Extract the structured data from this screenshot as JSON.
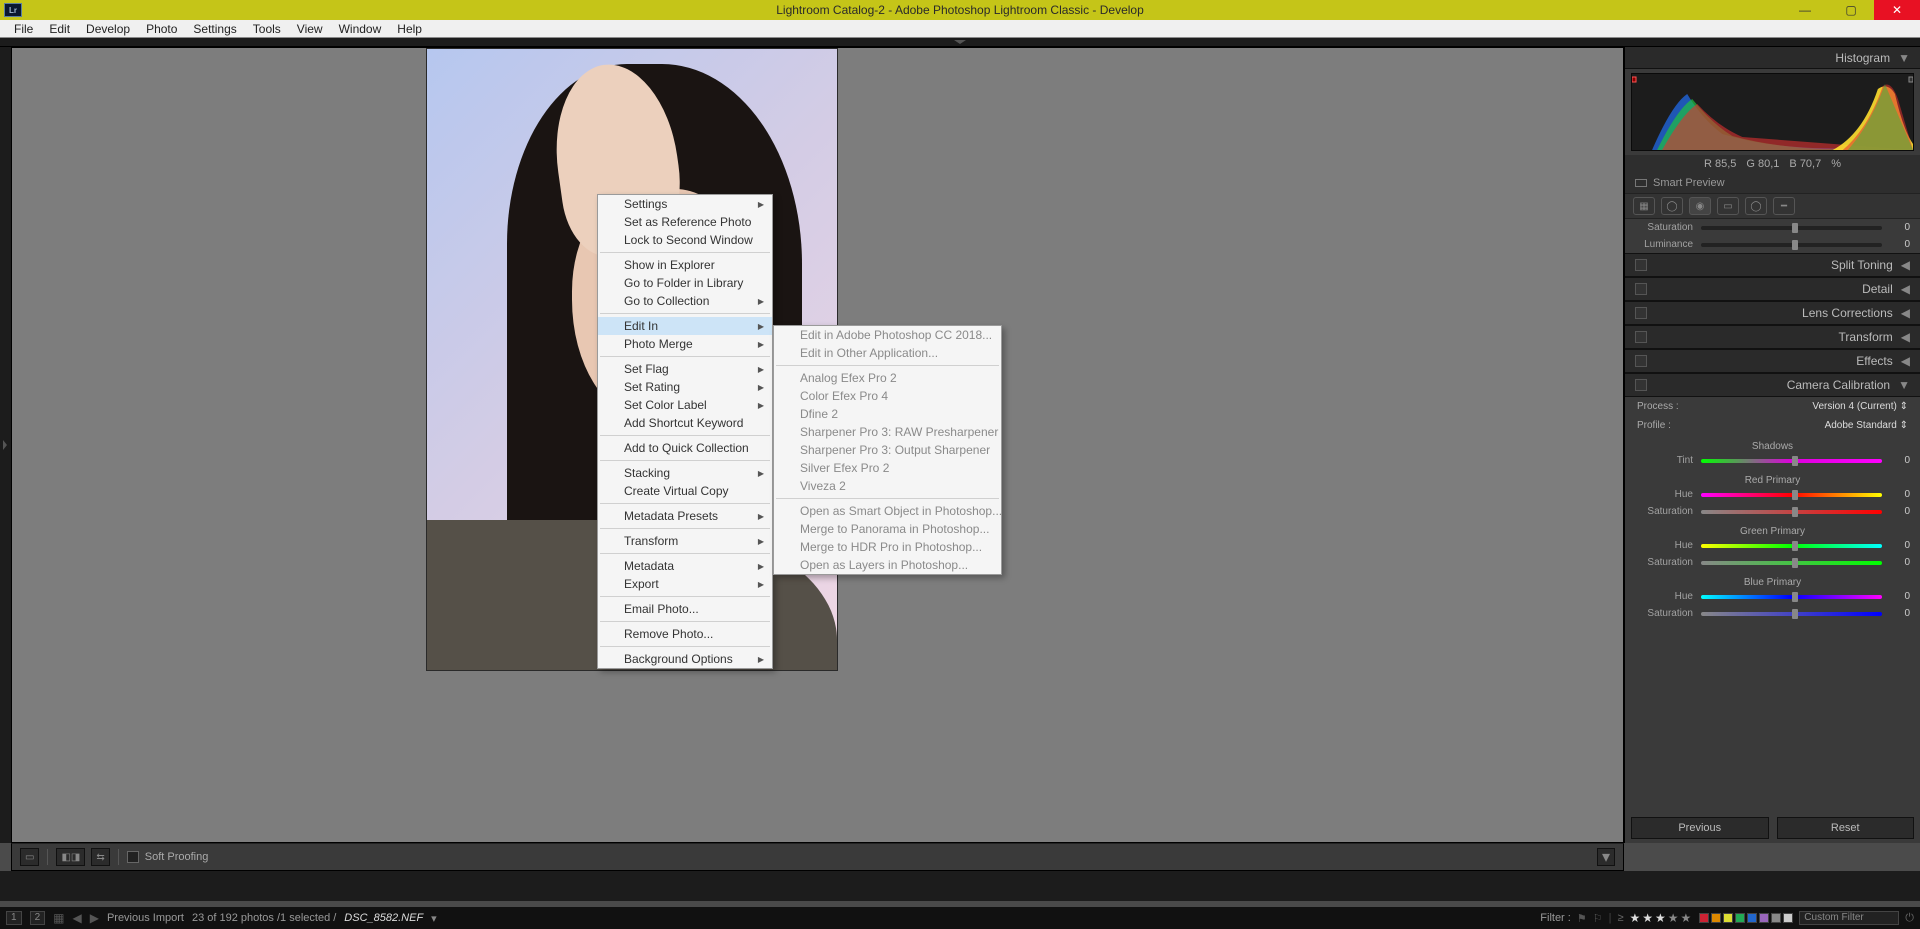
{
  "window": {
    "title": "Lightroom Catalog-2 - Adobe Photoshop Lightroom Classic - Develop",
    "app_icon_text": "Lr"
  },
  "menubar": [
    "File",
    "Edit",
    "Develop",
    "Photo",
    "Settings",
    "Tools",
    "View",
    "Window",
    "Help"
  ],
  "context_menu": {
    "items": [
      {
        "label": "Settings",
        "sub": true
      },
      {
        "label": "Set as Reference Photo"
      },
      {
        "label": "Lock to Second Window"
      },
      {
        "sep": true
      },
      {
        "label": "Show in Explorer"
      },
      {
        "label": "Go to Folder in Library"
      },
      {
        "label": "Go to Collection",
        "sub": true
      },
      {
        "sep": true
      },
      {
        "label": "Edit In",
        "sub": true,
        "hover": true
      },
      {
        "label": "Photo Merge",
        "sub": true
      },
      {
        "sep": true
      },
      {
        "label": "Set Flag",
        "sub": true
      },
      {
        "label": "Set Rating",
        "sub": true
      },
      {
        "label": "Set Color Label",
        "sub": true
      },
      {
        "label": "Add Shortcut Keyword"
      },
      {
        "sep": true
      },
      {
        "label": "Add to Quick Collection"
      },
      {
        "sep": true
      },
      {
        "label": "Stacking",
        "sub": true
      },
      {
        "label": "Create Virtual Copy"
      },
      {
        "sep": true
      },
      {
        "label": "Metadata Presets",
        "sub": true
      },
      {
        "sep": true
      },
      {
        "label": "Transform",
        "sub": true
      },
      {
        "sep": true
      },
      {
        "label": "Metadata",
        "sub": true
      },
      {
        "label": "Export",
        "sub": true
      },
      {
        "sep": true
      },
      {
        "label": "Email Photo..."
      },
      {
        "sep": true
      },
      {
        "label": "Remove Photo..."
      },
      {
        "sep": true
      },
      {
        "label": "Background Options",
        "sub": true
      }
    ],
    "edit_in_submenu": [
      {
        "label": "Edit in Adobe Photoshop CC 2018..."
      },
      {
        "label": "Edit in Other Application..."
      },
      {
        "sep": true
      },
      {
        "label": "Analog Efex Pro 2"
      },
      {
        "label": "Color Efex Pro 4"
      },
      {
        "label": "Dfine 2"
      },
      {
        "label": "Sharpener Pro 3: RAW Presharpener"
      },
      {
        "label": "Sharpener Pro 3: Output Sharpener"
      },
      {
        "label": "Silver Efex Pro 2"
      },
      {
        "label": "Viveza 2"
      },
      {
        "sep": true
      },
      {
        "label": "Open as Smart Object in Photoshop..."
      },
      {
        "label": "Merge to Panorama in Photoshop..."
      },
      {
        "label": "Merge to HDR Pro in Photoshop..."
      },
      {
        "label": "Open as Layers in Photoshop..."
      }
    ]
  },
  "right_panel": {
    "histogram_title": "Histogram",
    "rgb": {
      "r": "R  85,5",
      "g": "G  80,1",
      "b": "B  70,7",
      "pct": "%"
    },
    "smart_preview": "Smart Preview",
    "truncated": {
      "saturation": "Saturation",
      "sat_val": "0",
      "luminance": "Luminance",
      "lum_val": "0"
    },
    "sections": [
      "Split Toning",
      "Detail",
      "Lens Corrections",
      "Transform",
      "Effects",
      "Camera Calibration"
    ],
    "camera_cal": {
      "process_label": "Process :",
      "process_value": "Version 4 (Current) ⇕",
      "profile_label": "Profile :",
      "profile_value": "Adobe Standard ⇕",
      "shadows": {
        "title": "Shadows",
        "tint_label": "Tint",
        "tint_val": "0"
      },
      "red": {
        "title": "Red Primary",
        "hue_label": "Hue",
        "hue_val": "0",
        "sat_label": "Saturation",
        "sat_val": "0"
      },
      "green": {
        "title": "Green Primary",
        "hue_label": "Hue",
        "hue_val": "0",
        "sat_label": "Saturation",
        "sat_val": "0"
      },
      "blue": {
        "title": "Blue Primary",
        "hue_label": "Hue",
        "hue_val": "0",
        "sat_label": "Saturation",
        "sat_val": "0"
      }
    },
    "previous_btn": "Previous",
    "reset_btn": "Reset"
  },
  "canvas_toolbar": {
    "soft_proofing": "Soft Proofing"
  },
  "statusbar": {
    "screen1": "1",
    "screen2": "2",
    "previous_import": "Previous Import",
    "count_text": "23 of 192 photos /1 selected /",
    "filename": "DSC_8582.NEF",
    "filter_label": "Filter :",
    "custom_filter": "Custom Filter",
    "color_labels": [
      "#c23",
      "#d80",
      "#dd3",
      "#2a5",
      "#26c",
      "#96b",
      "#888",
      "#ccc"
    ]
  }
}
